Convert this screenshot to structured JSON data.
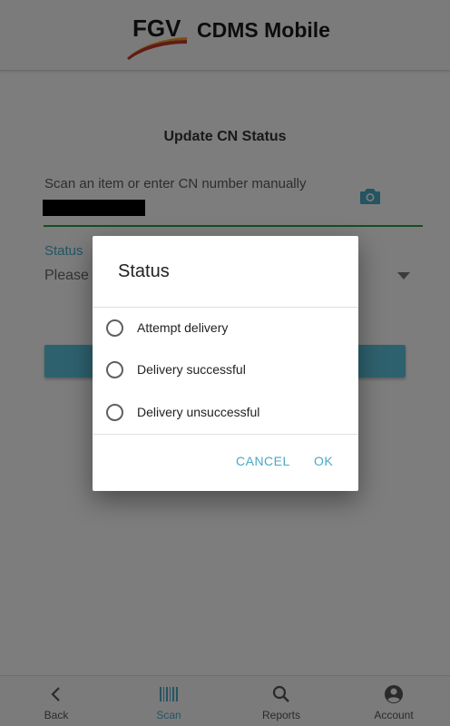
{
  "header": {
    "logo_text": "FGV",
    "app_title": "CDMS Mobile"
  },
  "main": {
    "page_title": "Update CN Status",
    "scan_placeholder": "Scan an item or enter CN number manually",
    "status_label": "Status",
    "status_value": "Please"
  },
  "dialog": {
    "title": "Status",
    "options": [
      {
        "label": "Attempt delivery",
        "selected": false
      },
      {
        "label": "Delivery successful",
        "selected": false
      },
      {
        "label": "Delivery unsuccessful",
        "selected": false
      }
    ],
    "cancel_label": "CANCEL",
    "ok_label": "OK"
  },
  "bottom_nav": {
    "items": [
      {
        "label": "Back",
        "icon": "chevron-left-icon",
        "active": false
      },
      {
        "label": "Scan",
        "icon": "barcode-icon",
        "active": true
      },
      {
        "label": "Reports",
        "icon": "search-icon",
        "active": false
      },
      {
        "label": "Account",
        "icon": "account-circle-icon",
        "active": false
      }
    ]
  },
  "colors": {
    "accent": "#4aa8c4",
    "underline_active": "#2e9d3a",
    "button": "#5cc2dc"
  }
}
